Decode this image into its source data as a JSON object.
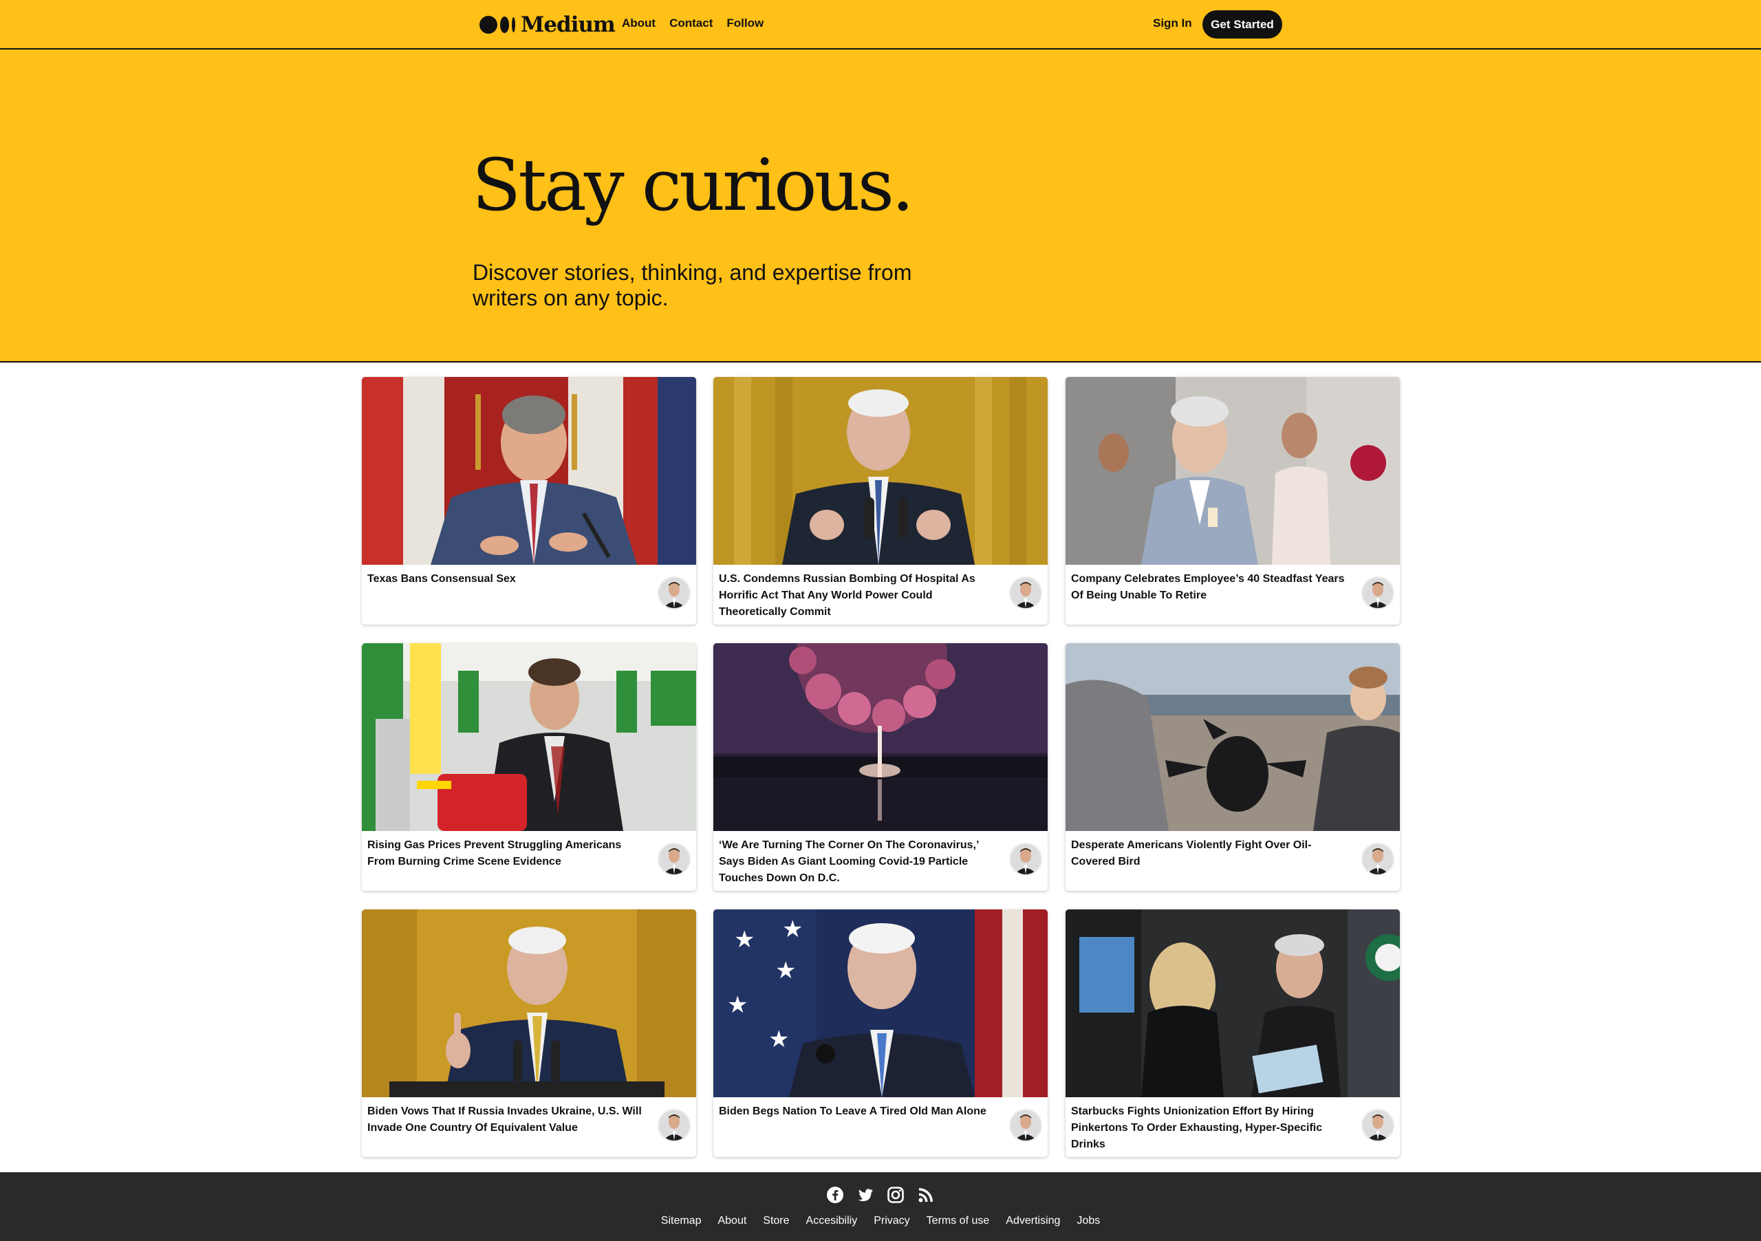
{
  "nav": {
    "logo_text": "Medium",
    "links": [
      "About",
      "Contact",
      "Follow"
    ],
    "signin": "Sign In",
    "cta": "Get Started"
  },
  "hero": {
    "title": "Stay curious.",
    "subtitle": "Discover stories, thinking, and expertise from writers on any topic."
  },
  "cards": [
    {
      "title": "Texas Bans Consensual Sex",
      "image": "politician-speaking-flags"
    },
    {
      "title": "U.S. Condemns Russian Bombing Of Hospital As Horrific Act That Any World Power Could Theoretically Commit",
      "image": "president-at-podium-gold"
    },
    {
      "title": "Company Celebrates Employee’s 40 Steadfast Years Of Being Unable To Retire",
      "image": "office-celebration-balloon"
    },
    {
      "title": "Rising Gas Prices Prevent Struggling Americans From Burning Crime Scene Evidence",
      "image": "man-gas-station-red-can"
    },
    {
      "title": "‘We Are Turning The Corner On The Coronavirus,’ Says Biden As Giant Looming Covid-19 Particle Touches Down On D.C.",
      "image": "virus-over-dc-night"
    },
    {
      "title": "Desperate Americans Violently Fight Over Oil-Covered Bird",
      "image": "beach-oily-bird-struggle"
    },
    {
      "title": "Biden Vows That If Russia Invades Ukraine, U.S. Will Invade One Country Of Equivalent Value",
      "image": "president-finger-raised"
    },
    {
      "title": "Biden Begs Nation To Leave A Tired Old Man Alone",
      "image": "president-flag-background"
    },
    {
      "title": "Starbucks Fights Unionization Effort By Hiring Pinkertons To Order Exhausting, Hyper-Specific Drinks",
      "image": "coffee-shop-counter"
    }
  ],
  "footer": {
    "social": [
      "facebook-icon",
      "twitter-icon",
      "instagram-icon",
      "rss-icon"
    ],
    "links": [
      "Sitemap",
      "About",
      "Store",
      "Accesibiliy",
      "Privacy",
      "Terms of use",
      "Advertising",
      "Jobs"
    ]
  },
  "colors": {
    "brand_yellow": "#FFC017",
    "ink": "#111111",
    "footer_bg": "#2a2a2a"
  }
}
